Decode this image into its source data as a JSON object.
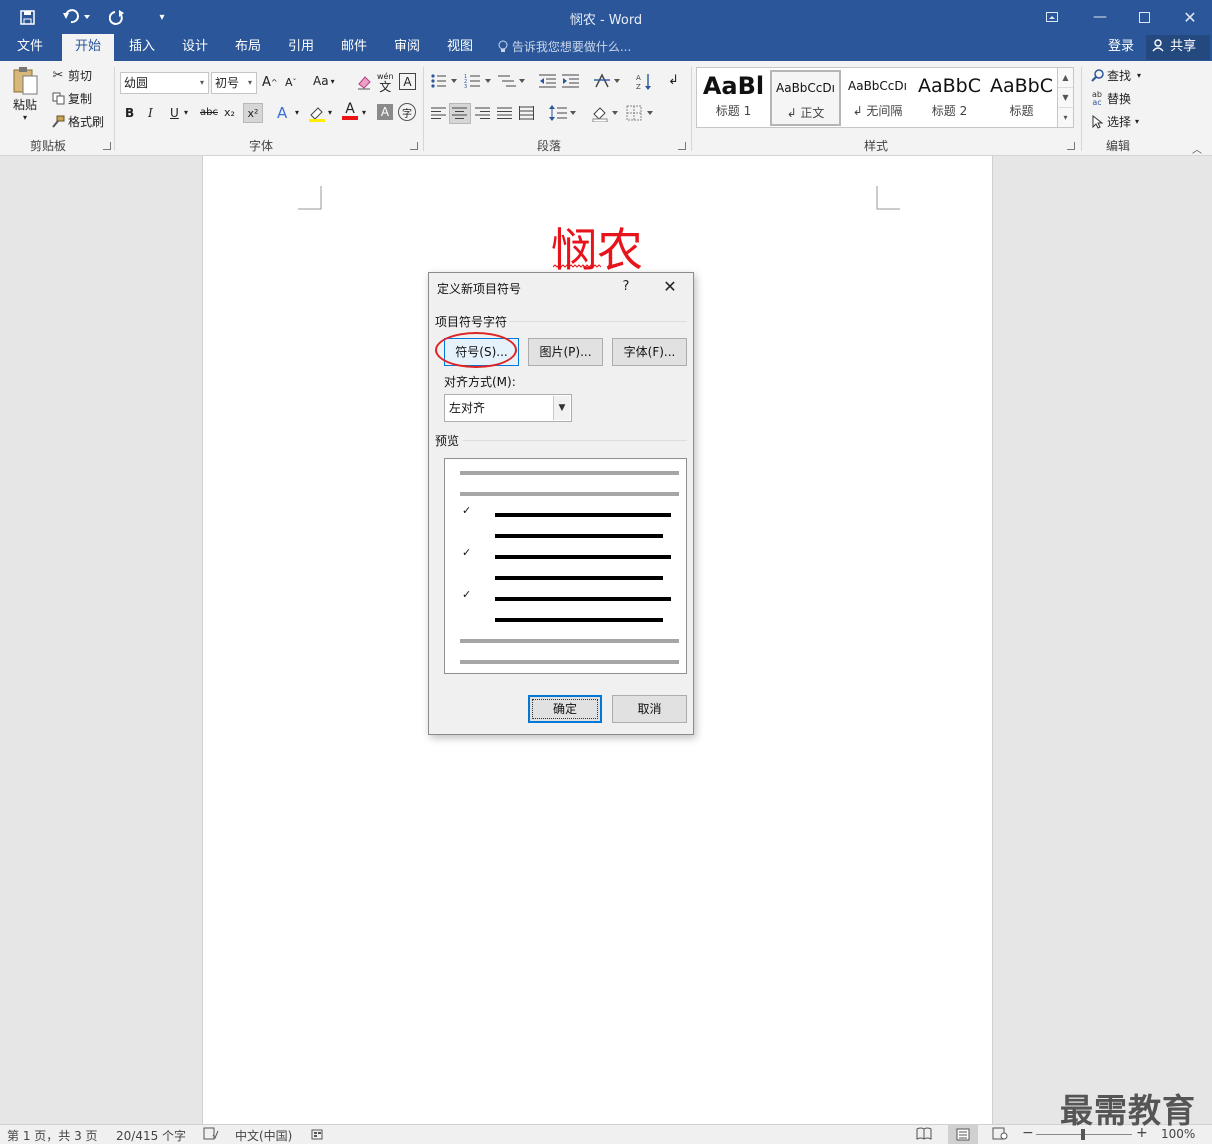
{
  "app": {
    "window_title": "悯农 - Word"
  },
  "quick_access": {
    "save_icon": "save-icon",
    "undo_icon": "undo-icon",
    "redo_icon": "redo-icon",
    "customize_icon": "customize-icon"
  },
  "tabs": [
    {
      "label": "文件"
    },
    {
      "label": "开始",
      "active": true
    },
    {
      "label": "插入"
    },
    {
      "label": "设计"
    },
    {
      "label": "布局"
    },
    {
      "label": "引用"
    },
    {
      "label": "邮件"
    },
    {
      "label": "审阅"
    },
    {
      "label": "视图"
    }
  ],
  "tell_me": "告诉我您想要做什么...",
  "account": {
    "login": "登录",
    "share": "共享"
  },
  "clipboard": {
    "label": "剪贴板",
    "paste": "粘贴",
    "cut": "剪切",
    "copy": "复制",
    "format_painter": "格式刷"
  },
  "font": {
    "label": "字体",
    "font_name": "幼圆",
    "font_size": "初号",
    "change_case": "Aa",
    "bold": "B",
    "italic": "I",
    "underline": "U",
    "strike": "abc",
    "subscript": "x₂",
    "superscript": "x²",
    "phonetic": "wén",
    "border_char": "A"
  },
  "paragraph": {
    "label": "段落"
  },
  "styles": {
    "label": "样式",
    "items": [
      {
        "sample": "AaBl",
        "name": "标题 1"
      },
      {
        "sample": "AaBbCcDı",
        "name": "↲ 正文",
        "selected": true
      },
      {
        "sample": "AaBbCcDı",
        "name": "↲ 无间隔"
      },
      {
        "sample": "AaBbC",
        "name": "标题 2"
      },
      {
        "sample": "AaBbC",
        "name": "标题"
      }
    ]
  },
  "editing": {
    "label": "编辑",
    "find": "查找",
    "replace": "替换",
    "select": "选择"
  },
  "document": {
    "heading": "悯农",
    "heading_color": "#e8141c"
  },
  "dialog": {
    "title": "定义新项目符号",
    "help": "?",
    "section_char": "项目符号字符",
    "symbol_button": "符号(S)...",
    "picture_button": "图片(P)...",
    "font_button": "字体(F)...",
    "align_label": "对齐方式(M):",
    "align_value": "左对齐",
    "preview_label": "预览",
    "ok": "确定",
    "cancel": "取消",
    "preview_bullet": "✓"
  },
  "status": {
    "page": "第 1 页，共 3 页",
    "words": "20/415 个字",
    "language": "中文(中国)",
    "zoom": "100%"
  },
  "watermark": "最需教育"
}
